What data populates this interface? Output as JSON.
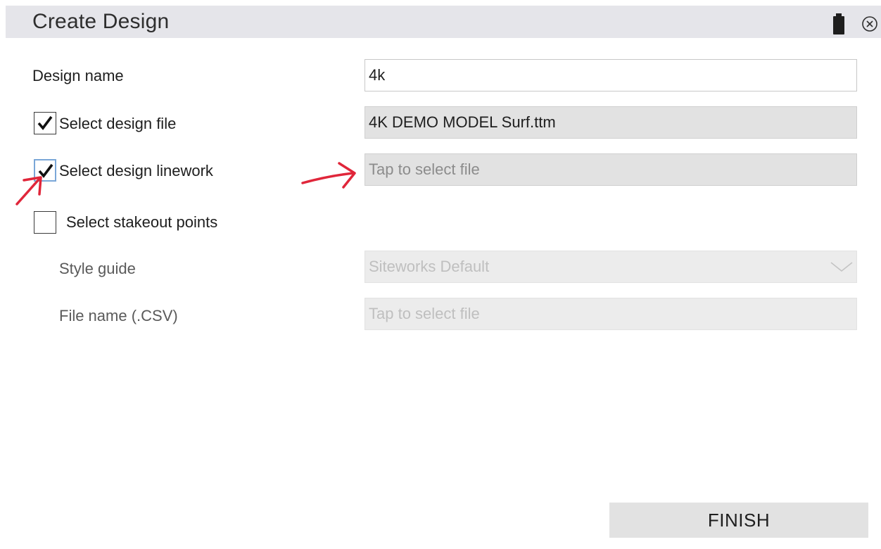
{
  "window": {
    "title": "Create Design"
  },
  "icons": {
    "battery": "battery-icon",
    "close": "close-circle-icon",
    "chevron": "chevron-down-icon",
    "checkmark": "checkmark-icon",
    "annotation_arrow": "red-arrow-annotation"
  },
  "form": {
    "design_name": {
      "label": "Design name",
      "value": "4k"
    },
    "design_file": {
      "label": "Select design file",
      "checked": true,
      "value": "4K DEMO MODEL Surf.ttm"
    },
    "design_linework": {
      "label": "Select design linework",
      "checked": true,
      "placeholder": "Tap to select file"
    },
    "stakeout_points": {
      "label": "Select stakeout points",
      "checked": false
    },
    "style_guide": {
      "label": "Style guide",
      "value": "Siteworks Default"
    },
    "csv_file": {
      "label": "File name (.CSV)",
      "placeholder": "Tap to select file"
    }
  },
  "actions": {
    "finish_label": "FINISH"
  },
  "colors": {
    "titlebar": "#e5e5ea",
    "field_gray": "#e2e2e2",
    "annotation_red": "#e0263a",
    "focus_blue": "#7aa7d8"
  }
}
